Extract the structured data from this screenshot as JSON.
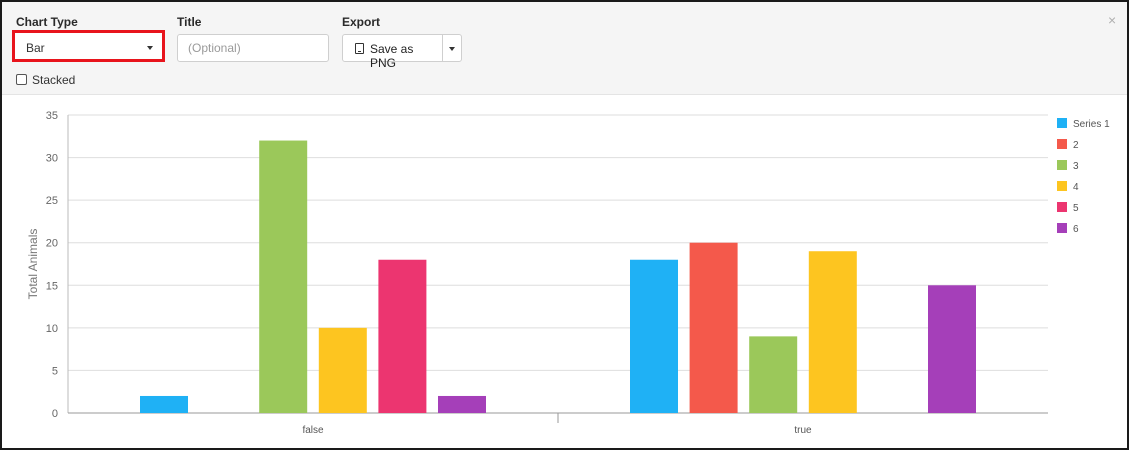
{
  "toolbar": {
    "chart_type_label": "Chart Type",
    "chart_type_value": "Bar",
    "title_label": "Title",
    "title_placeholder": "(Optional)",
    "export_label": "Export",
    "save_png_label": "Save as PNG",
    "stacked_label": "Stacked",
    "stacked_checked": false,
    "close_symbol": "×",
    "highlight_color": "#e8141c"
  },
  "chart_data": {
    "type": "bar",
    "categories": [
      "false",
      "true"
    ],
    "ylabel": "Total Animals",
    "xlabel": "",
    "ylim": [
      0,
      35
    ],
    "yticks": [
      0,
      5,
      10,
      15,
      20,
      25,
      30,
      35
    ],
    "grid": true,
    "legend_position": "right",
    "series": [
      {
        "name": "Series 1",
        "color": "#1fb1f5",
        "values": [
          2,
          18
        ]
      },
      {
        "name": "2",
        "color": "#f4594b",
        "values": [
          0,
          20
        ]
      },
      {
        "name": "3",
        "color": "#9bc85a",
        "values": [
          32,
          9
        ]
      },
      {
        "name": "4",
        "color": "#fdc520",
        "values": [
          10,
          19
        ]
      },
      {
        "name": "5",
        "color": "#ec3570",
        "values": [
          18,
          0
        ]
      },
      {
        "name": "6",
        "color": "#a53fb9",
        "values": [
          2,
          15
        ]
      }
    ]
  }
}
